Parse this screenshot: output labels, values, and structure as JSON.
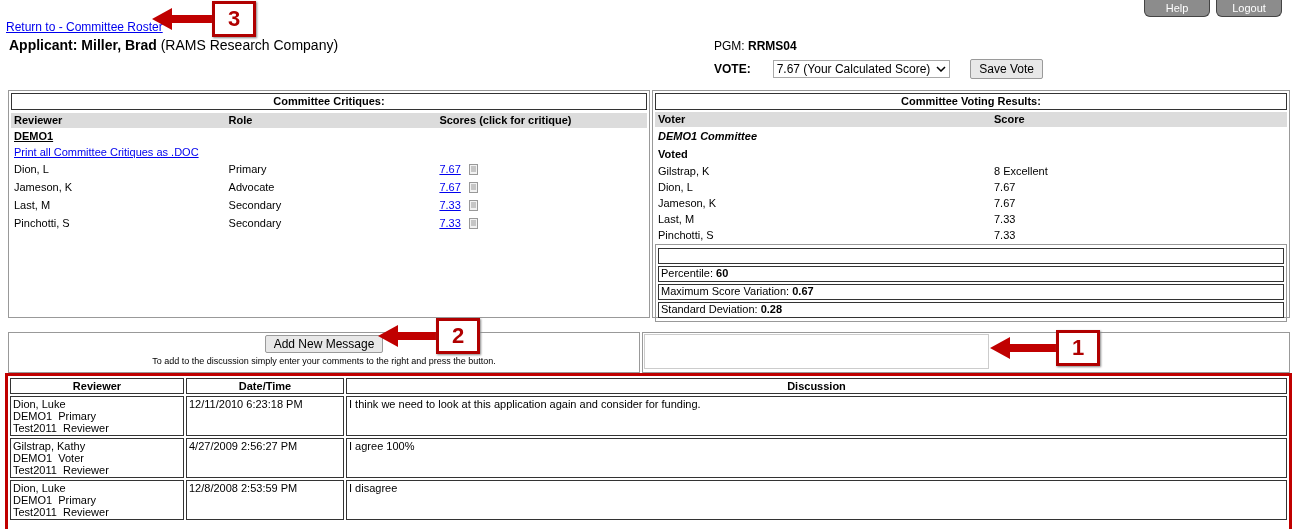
{
  "header_buttons": [
    "Help",
    "Logout"
  ],
  "return_link": "Return to - Committee Roster",
  "applicant": {
    "label": "Applicant:",
    "name": "Miller, Brad",
    "company": "(RAMS Research Company)"
  },
  "pgm": {
    "label": "PGM:",
    "value": "RRMS04"
  },
  "vote": {
    "label": "VOTE:",
    "value": "7.67 (Your Calculated Score)",
    "button": "Save Vote"
  },
  "critiques": {
    "title": "Committee Critiques:",
    "columns": [
      "Reviewer",
      "Role",
      "Scores (click for critique)"
    ],
    "group": "DEMO1",
    "print_link": "Print all Committee Critiques as .DOC",
    "rows": [
      {
        "reviewer": "Dion, L",
        "role": "Primary",
        "score": "7.67"
      },
      {
        "reviewer": "Jameson, K",
        "role": "Advocate",
        "score": "7.67"
      },
      {
        "reviewer": "Last, M",
        "role": "Secondary",
        "score": "7.33"
      },
      {
        "reviewer": "Pinchotti, S",
        "role": "Secondary",
        "score": "7.33"
      }
    ]
  },
  "voting": {
    "title": "Committee Voting Results:",
    "columns": [
      "Voter",
      "Score"
    ],
    "committee": "DEMO1 Committee",
    "section": "Voted",
    "rows": [
      {
        "voter": "Gilstrap, K",
        "score": "8 Excellent"
      },
      {
        "voter": "Dion, L",
        "score": "7.67"
      },
      {
        "voter": "Jameson, K",
        "score": "7.67"
      },
      {
        "voter": "Last, M",
        "score": "7.33"
      },
      {
        "voter": "Pinchotti, S",
        "score": "7.33"
      }
    ],
    "stats": [
      {
        "label": "Percentile:",
        "value": "60"
      },
      {
        "label": "Maximum Score Variation:",
        "value": "0.67"
      },
      {
        "label": "Standard Deviation:",
        "value": "0.28"
      }
    ]
  },
  "message": {
    "button": "Add New Message",
    "hint": "To add to the discussion simply enter your comments to the right and press the button."
  },
  "discussion": {
    "columns": [
      "Reviewer",
      "Date/Time",
      "Discussion"
    ],
    "rows": [
      {
        "reviewer": [
          "Dion, Luke",
          "DEMO1  Primary",
          "Test2011  Reviewer"
        ],
        "datetime": "12/11/2010 6:23:18 PM",
        "text": "I think we need to look at this application again and consider for funding."
      },
      {
        "reviewer": [
          "Gilstrap, Kathy",
          "DEMO1  Voter",
          "Test2011  Reviewer"
        ],
        "datetime": "4/27/2009 2:56:27 PM",
        "text": "I agree 100%"
      },
      {
        "reviewer": [
          "Dion, Luke",
          "DEMO1  Primary",
          "Test2011  Reviewer"
        ],
        "datetime": "12/8/2008 2:53:59 PM",
        "text": "I disagree"
      }
    ]
  },
  "callouts": [
    {
      "label": "3"
    },
    {
      "label": "2"
    },
    {
      "label": "1"
    }
  ]
}
